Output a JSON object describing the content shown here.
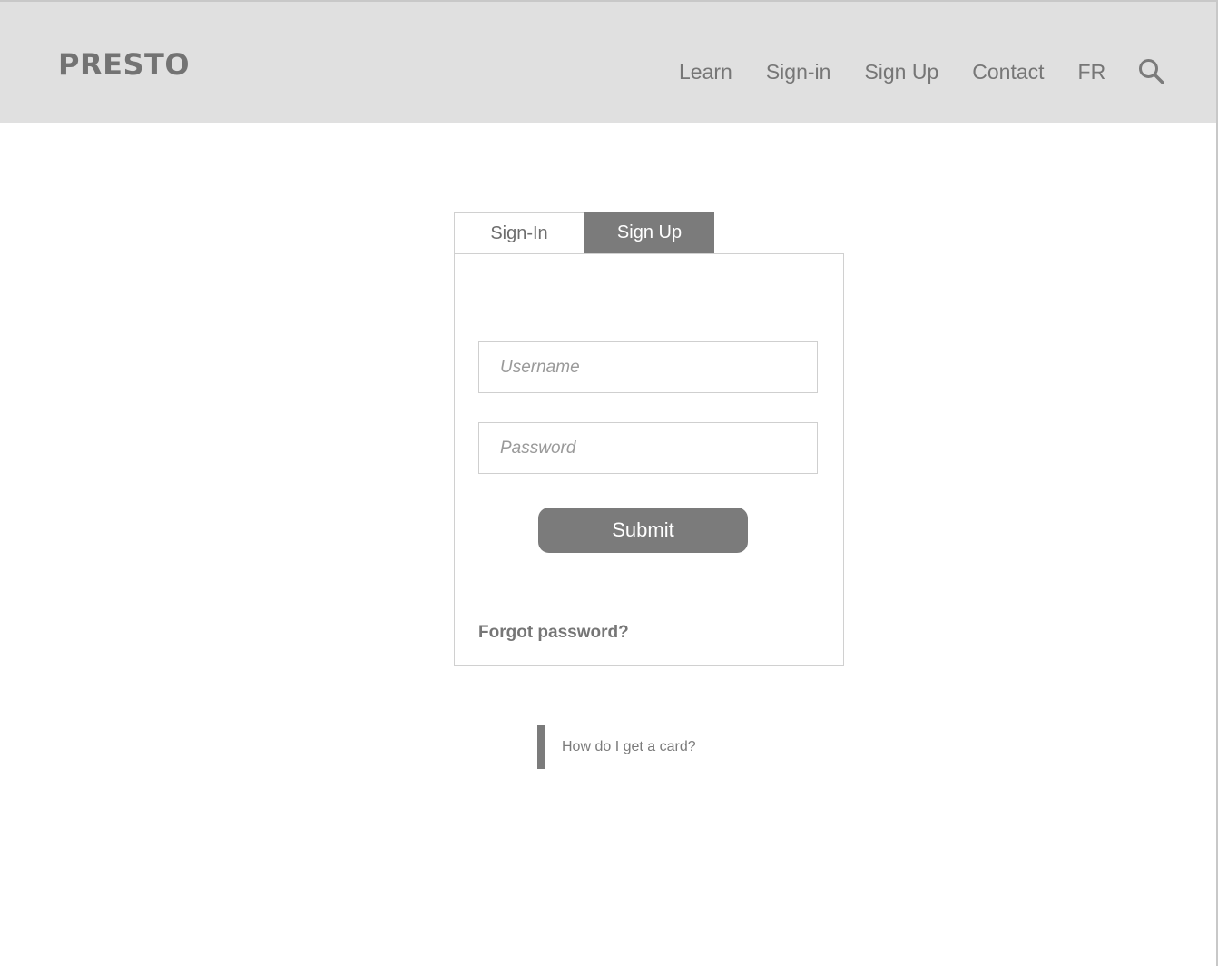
{
  "header": {
    "logo": "PRESTO",
    "nav": [
      {
        "label": "Learn"
      },
      {
        "label": "Sign-in"
      },
      {
        "label": "Sign Up"
      },
      {
        "label": "Contact"
      },
      {
        "label": "FR"
      }
    ],
    "search_icon": "search-icon"
  },
  "auth": {
    "tabs": [
      {
        "label": "Sign-In",
        "active": false
      },
      {
        "label": "Sign Up",
        "active": true
      }
    ],
    "username": {
      "placeholder": "Username",
      "value": ""
    },
    "password": {
      "placeholder": "Password",
      "value": ""
    },
    "submit_label": "Submit",
    "forgot_label": "Forgot password?"
  },
  "help": {
    "label": "How do I get a card?"
  },
  "colors": {
    "header_bg": "#e0e0e0",
    "accent": "#7b7b7b",
    "text": "#767676",
    "border": "#d0d0d0"
  }
}
